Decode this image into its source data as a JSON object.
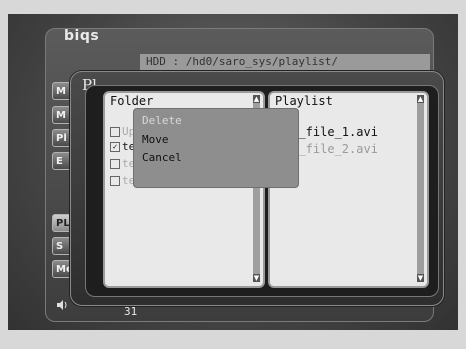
{
  "app": {
    "logo": "biqs"
  },
  "path_bar": {
    "text": "HDD : /hd0/saro_sys/playlist/"
  },
  "dialog": {
    "title": "Pl"
  },
  "side_menu": [
    {
      "label": "M",
      "active": false
    },
    {
      "label": "M",
      "active": false
    },
    {
      "label": "Pl",
      "active": false
    },
    {
      "label": "E",
      "active": false
    },
    {
      "label": "PL",
      "active": true
    },
    {
      "label": "S",
      "active": false
    },
    {
      "label": "Me",
      "active": false
    }
  ],
  "volume": {
    "icon": "speaker-icon",
    "value": "31"
  },
  "folder_pane": {
    "header": "Folder",
    "items": [
      {
        "text": "Up",
        "checked": false,
        "dim": true
      },
      {
        "text": "te",
        "checked": true,
        "dim": false
      },
      {
        "text": "te",
        "checked": false,
        "dim": true
      },
      {
        "text": "te",
        "checked": false,
        "dim": true
      }
    ]
  },
  "playlist_pane": {
    "header": "Playlist",
    "items": [
      {
        "text": "st_file_1.avi",
        "color": "#111111"
      },
      {
        "text": "st_file_2.avi",
        "color": "#9a9a9a"
      }
    ]
  },
  "context_menu": {
    "items": [
      {
        "label": "Delete",
        "enabled": false
      },
      {
        "label": "Move",
        "enabled": true
      },
      {
        "label": "Cancel",
        "enabled": true
      }
    ]
  }
}
